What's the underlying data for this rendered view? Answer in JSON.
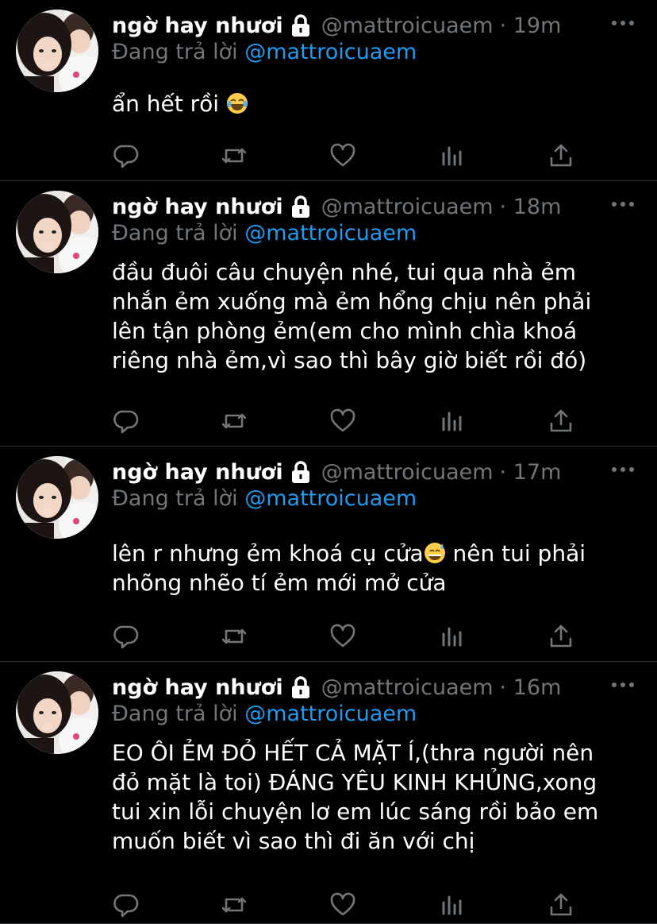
{
  "tweets": [
    {
      "name": "ngờ hay nhươi",
      "handle": "@mattroicuaem",
      "time": "· 19m",
      "reply_prefix": "Đang trả lời",
      "reply_handle": "@mattroicuaem",
      "text_lines": [
        "ẩn hết rồi"
      ]
    },
    {
      "name": "ngờ hay nhươi",
      "handle": "@mattroicuaem",
      "time": "· 18m",
      "reply_prefix": "Đang trả lời",
      "reply_handle": "@mattroicuaem",
      "text_lines": [
        "đầu đuôi câu chuyện nhé, tui qua nhà ẻm",
        "nhắn ẻm xuống mà ẻm hổng chịu nên phải",
        "lên tận phòng ẻm(em cho mình chìa khoá",
        "riêng nhà ẻm,vì sao thì bây giờ biết rồi đó)"
      ]
    },
    {
      "name": "ngờ hay nhươi",
      "handle": "@mattroicuaem",
      "time": "· 17m",
      "reply_prefix": "Đang trả lời",
      "reply_handle": "@mattroicuaem",
      "text_lines": [
        "lên r nhưng ẻm khoá cụ cửa",
        "nhõng nhẽo tí ẻm mới mở cửa"
      ],
      "text_after_emoji": " nên tui phải"
    },
    {
      "name": "ngờ hay nhươi",
      "handle": "@mattroicuaem",
      "time": "· 16m",
      "reply_prefix": "Đang trả lời",
      "reply_handle": "@mattroicuaem",
      "text_lines": [
        "EO ÔI ẺM ĐỎ HẾT CẢ MẶT Í,(thra người nên",
        "đỏ mặt là toi) ĐÁNG YÊU KINH KHỦNG,xong",
        "tui xin lỗi chuyện lơ em lúc sáng rồi bảo em",
        "muốn biết vì sao thì đi ăn với chị"
      ]
    }
  ],
  "icons": {
    "reply": "reply-icon",
    "retweet": "retweet-icon",
    "like": "heart-icon",
    "views": "views-icon",
    "share": "share-icon",
    "more": "more-icon",
    "lock": "lock-icon"
  },
  "colors": {
    "background": "#000000",
    "text": "#ffffff",
    "muted": "#71767b",
    "link": "#1d9bf0",
    "divider": "#2f3336"
  }
}
